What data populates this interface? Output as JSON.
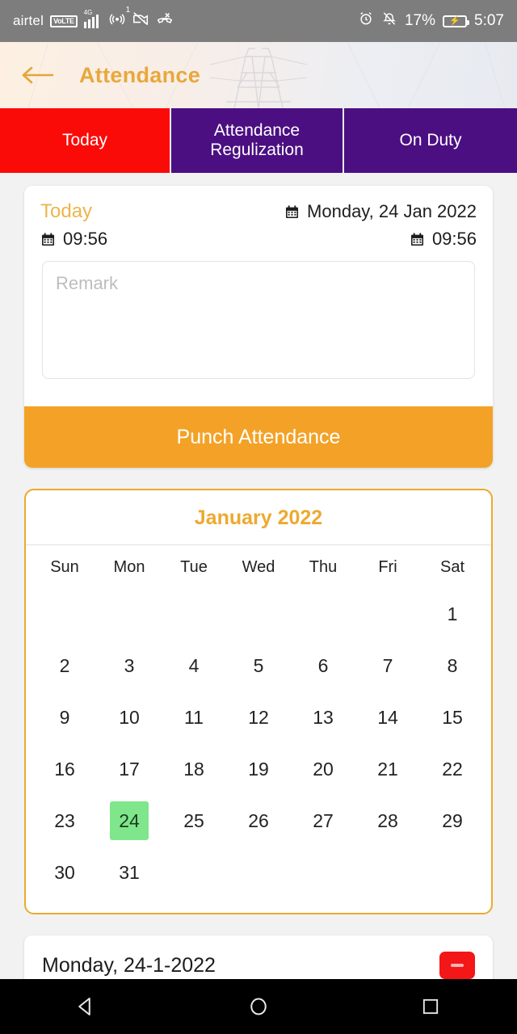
{
  "status_bar": {
    "carrier": "airtel",
    "volte_label": "VoLTE",
    "network_type": "4G",
    "hotspot_superscript": "1",
    "battery_percent": "17%",
    "time": "5:07",
    "icons": [
      "wifi-icon",
      "volte-icon",
      "signal-bars-icon",
      "hotspot-icon",
      "camera-off-icon",
      "missed-call-icon",
      "alarm-icon",
      "mute-icon",
      "battery-charging-icon"
    ]
  },
  "app_bar": {
    "back_icon": "back-arrow-icon",
    "title": "Attendance"
  },
  "tabs": [
    {
      "label": "Today",
      "active": true,
      "color": "#fb0b08"
    },
    {
      "label": "Attendance Regulization",
      "active": false,
      "color": "#4b0f82"
    },
    {
      "label": "On Duty",
      "active": false,
      "color": "#4b0f82"
    }
  ],
  "today_card": {
    "heading": "Today",
    "date": "Monday, 24 Jan 2022",
    "time_left": "09:56",
    "time_right": "09:56",
    "calendar_icon": "calendar-icon",
    "remark_placeholder": "Remark",
    "remark_value": "",
    "punch_button": "Punch Attendance",
    "accent_color": "#f3a227"
  },
  "calendar": {
    "title": "January 2022",
    "month": "January",
    "year": "2022",
    "weekdays": [
      "Sun",
      "Mon",
      "Tue",
      "Wed",
      "Thu",
      "Fri",
      "Sat"
    ],
    "leading_blanks": 6,
    "days": [
      1,
      2,
      3,
      4,
      5,
      6,
      7,
      8,
      9,
      10,
      11,
      12,
      13,
      14,
      15,
      16,
      17,
      18,
      19,
      20,
      21,
      22,
      23,
      24,
      25,
      26,
      27,
      28,
      29,
      30,
      31
    ],
    "selected_day": 24,
    "selected_color": "#7fe68c",
    "border_color": "#eda92f",
    "title_color": "#eda92f"
  },
  "bottom_card": {
    "date": "Monday, 24-1-2022",
    "badge_color": "#f31717"
  },
  "nav_bar": {
    "back": "nav-back-icon",
    "home": "nav-home-icon",
    "recents": "nav-recents-icon"
  }
}
